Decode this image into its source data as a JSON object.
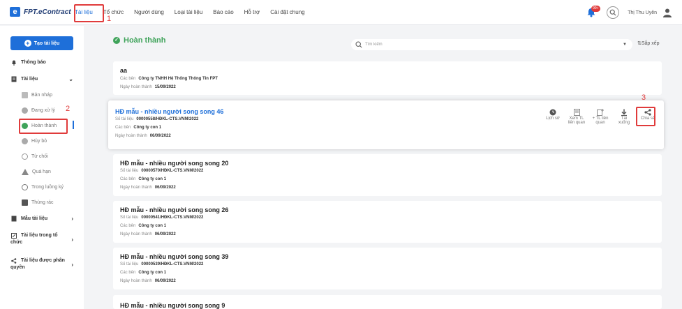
{
  "app": {
    "logo_letter": "e",
    "logo_text": "FPT.eContract"
  },
  "nav": {
    "items": [
      "Tài liệu",
      "Tổ chức",
      "Người dùng",
      "Loại tài liệu",
      "Báo cáo",
      "Hỗ trợ",
      "Cài đặt chung"
    ],
    "active_index": 0
  },
  "topbar": {
    "notification_badge": "99+",
    "user_name": "Thị Thu Uyên"
  },
  "annotations": {
    "one": "1",
    "two": "2",
    "three": "3"
  },
  "sidebar": {
    "create_button": "Tạo tài liệu",
    "notifications": "Thông báo",
    "documents": "Tài liệu",
    "sub_items": [
      "Bản nháp",
      "Đang xử lý",
      "Hoàn thành",
      "Hủy bỏ",
      "Từ chối",
      "Quá hạn",
      "Trong luồng ký",
      "Thùng rác"
    ],
    "templates": "Mẫu tài liệu",
    "org_docs_line1": "Tài liệu trong tổ",
    "org_docs_line2": "chức",
    "shared_docs_line1": "Tài liệu được phân",
    "shared_docs_line2": "quyền"
  },
  "main": {
    "section_title": "Hoàn thành",
    "search_placeholder": "Tìm kiếm",
    "sort_label": "Sắp xếp"
  },
  "labels": {
    "doc_number": "Số tài liệu",
    "parties": "Các bên",
    "completed_date": "Ngày hoàn thành"
  },
  "actions": {
    "history": "Lịch sử",
    "view_related_1": "Xem TL",
    "view_related_2": "liên quan",
    "add_related_1": "+ TL liên",
    "add_related_2": "quan",
    "download": "Tải xuống",
    "share": "Chia sẻ"
  },
  "documents": [
    {
      "title": "aa",
      "number": "",
      "parties": "Công ty TNHH Hệ Thống Thông Tin FPT",
      "completed": "15/09/2022"
    },
    {
      "title": "HĐ mẫu - nhiều người song song 46",
      "number": "00000558/HĐKL-CTS.VNM/2022",
      "parties": "Công ty con 1",
      "completed": "06/09/2022"
    },
    {
      "title": "HĐ mẫu - nhiều người song song 20",
      "number": "00000570/HĐKL-CTS.VNM/2022",
      "parties": "Công ty con 1",
      "completed": "06/09/2022"
    },
    {
      "title": "HĐ mẫu - nhiều người song song 26",
      "number": "00000541/HĐKL-CTS.VNM/2022",
      "parties": "Công ty con 1",
      "completed": "06/09/2022"
    },
    {
      "title": "HĐ mẫu - nhiều người song song 39",
      "number": "00000539/HĐKL-CTS.VNM/2022",
      "parties": "Công ty con 1",
      "completed": "06/09/2022"
    },
    {
      "title": "HĐ mẫu - nhiều người song song 9",
      "number": "",
      "parties": "",
      "completed": ""
    }
  ]
}
